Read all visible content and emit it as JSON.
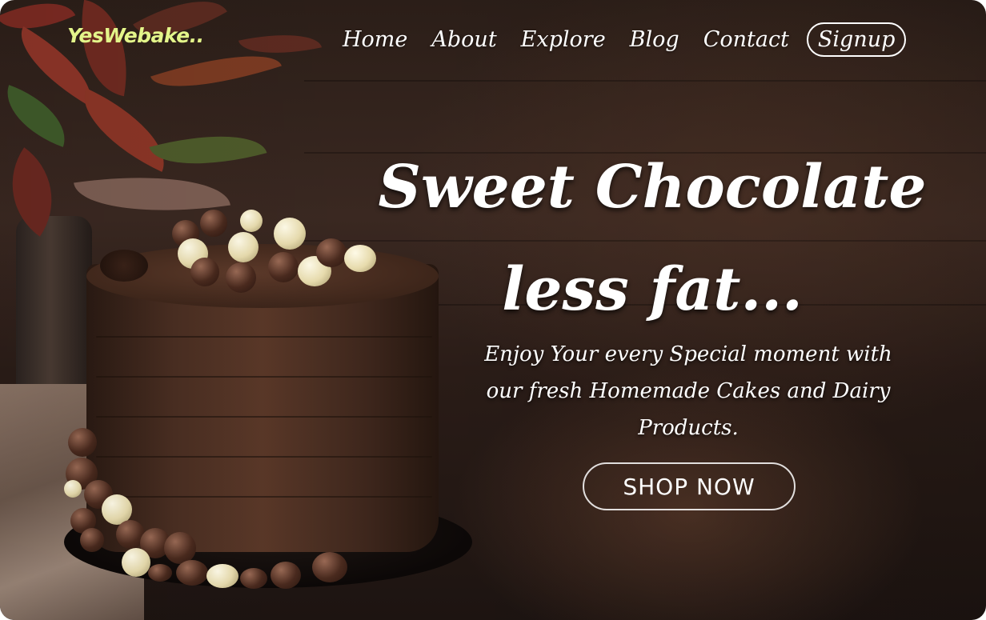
{
  "brand": {
    "logo": "YesWebake.."
  },
  "nav": {
    "items": [
      {
        "label": "Home"
      },
      {
        "label": "About"
      },
      {
        "label": "Explore"
      },
      {
        "label": "Blog"
      },
      {
        "label": "Contact"
      }
    ],
    "signup_label": "Signup"
  },
  "hero": {
    "headline_line1": "Sweet Chocolate",
    "headline_line2": "less fat...",
    "subtitle_line1": "Enjoy Your every Special moment with",
    "subtitle_line2": "our fresh Homemade Cakes and Dairy",
    "subtitle_line3": "Products.",
    "cta_label": "SHOP NOW",
    "image": "chocolate-cake-photo"
  },
  "colors": {
    "logo": "#e3f58a",
    "text": "#ffffff",
    "background": "#2b1e18"
  }
}
